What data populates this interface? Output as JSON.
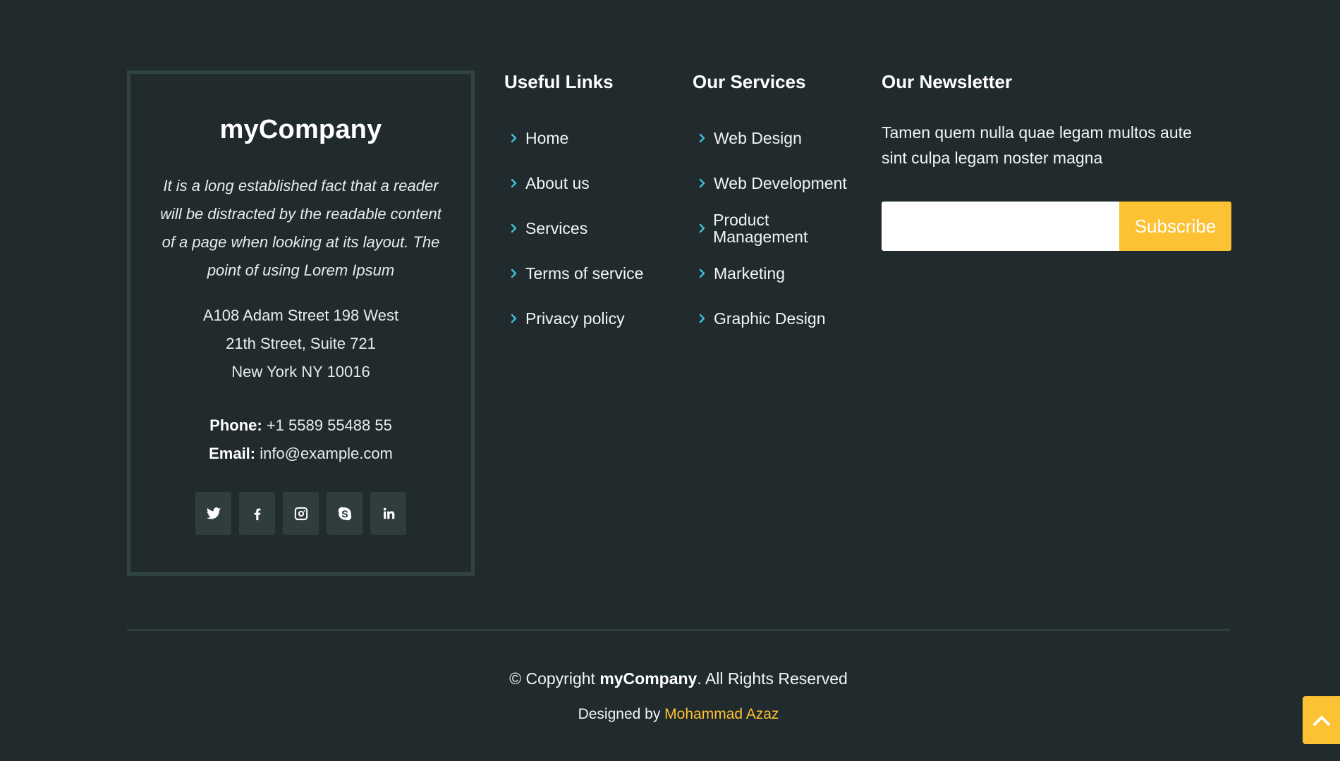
{
  "about": {
    "brand": "myCompany",
    "description": "It is a long established fact that a reader will be distracted by the readable content of a page when looking at its layout. The point of using Lorem Ipsum",
    "address_line1": "A108 Adam Street 198 West",
    "address_line2": "21th Street, Suite 721",
    "address_line3": "New York NY 10016",
    "phone_label": "Phone:",
    "phone_value": "+1 5589 55488 55",
    "email_label": "Email:",
    "email_value": "info@example.com",
    "socials": [
      "twitter-icon",
      "facebook-icon",
      "instagram-icon",
      "skype-icon",
      "linkedin-icon"
    ]
  },
  "useful_links": {
    "title": "Useful Links",
    "items": [
      "Home",
      "About us",
      "Services",
      "Terms of service",
      "Privacy policy"
    ]
  },
  "services": {
    "title": "Our Services",
    "items": [
      "Web Design",
      "Web Development",
      "Product Management",
      "Marketing",
      "Graphic Design"
    ]
  },
  "newsletter": {
    "title": "Our Newsletter",
    "text": "Tamen quem nulla quae legam multos aute sint culpa legam noster magna",
    "input_value": "",
    "button_label": "Subscribe"
  },
  "footer": {
    "copyright_prefix": "© Copyright",
    "copyright_brand": "myCompany",
    "copyright_suffix": ". All Rights Reserved",
    "designed_by": "Designed by",
    "designer": "Mohammad Azaz"
  },
  "colors": {
    "background": "#212a2d",
    "accent": "#fdc134",
    "chevron": "#3ec1d5",
    "card_border": "#2f4343"
  }
}
